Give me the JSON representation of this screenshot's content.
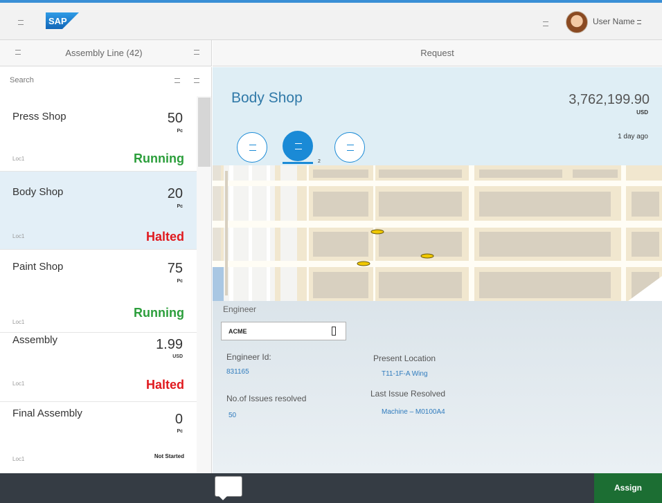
{
  "shell": {
    "logo_text": "SAP",
    "user_name": "User Name"
  },
  "master": {
    "title": "Assembly Line (42)",
    "search_placeholder": "Search",
    "items": [
      {
        "name": "Press Shop",
        "value": "50",
        "unit": "Pc",
        "location": "Loc1",
        "status": "Running",
        "status_kind": "running"
      },
      {
        "name": "Body Shop",
        "value": "20",
        "unit": "Pc",
        "location": "Loc1",
        "status": "Halted",
        "status_kind": "halted"
      },
      {
        "name": "Paint Shop",
        "value": "75",
        "unit": "Pc",
        "location": "Loc1",
        "status": "Running",
        "status_kind": "running"
      },
      {
        "name": "Assembly",
        "value": "1.99",
        "unit": "USD",
        "location": "Loc1",
        "status": "Halted",
        "status_kind": "halted"
      },
      {
        "name": "Final Assembly",
        "value": "0",
        "unit": "Pc",
        "location": "Loc1",
        "status": "Not Started",
        "status_kind": "not-started"
      }
    ]
  },
  "detail": {
    "title": "Request",
    "object": {
      "title": "Body Shop",
      "number": "3,762,199.90",
      "unit": "USD",
      "time": "1 day ago"
    },
    "tabs": {
      "active_count": "2"
    },
    "engineer": {
      "label": "Engineer",
      "selected": "ACME",
      "id_label": "Engineer Id:",
      "id_value": "831165",
      "issues_label": "No.of Issues resolved",
      "issues_value": "50",
      "location_label": "Present Location",
      "location_value": "T11-1F-A Wing",
      "last_issue_label": "Last Issue Resolved",
      "last_issue_value": "Machine – M0100A4"
    }
  },
  "footer": {
    "assign_label": "Assign"
  },
  "colors": {
    "accent": "#1a8ad6",
    "running": "#2b9e3b",
    "halted": "#e0191e",
    "assign": "#1c6e33",
    "footer": "#353c44"
  }
}
